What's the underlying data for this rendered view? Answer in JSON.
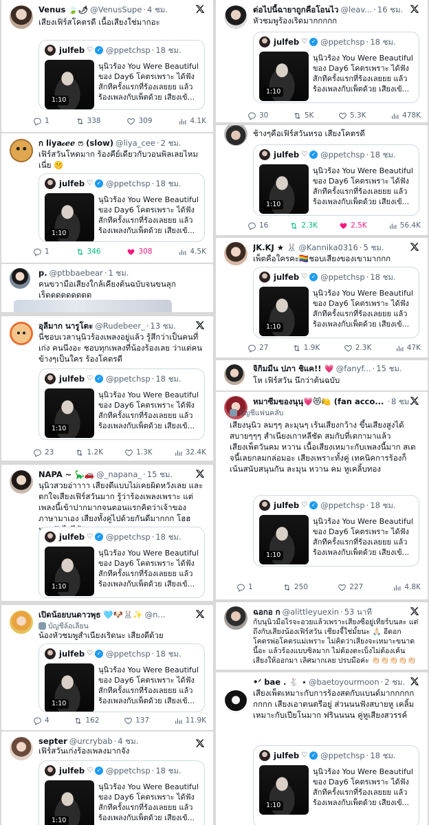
{
  "quoted": {
    "name": "julfeb",
    "heart": "♡",
    "handle": "@ppetchsp",
    "time": "18 ชม.",
    "lines": [
      "นุนิวร้อง You Were Beautiful",
      "ของ Day6 โคตรเพราะ ได้ฟัง",
      "สักทีครั้งแรกที่ร้องเลยยย แล้ว",
      "ร้องเพลงกับเพ็ตด้วย เสียงเข้..."
    ],
    "duration": "1:10"
  },
  "tweets": [
    {
      "name": "Venus 🍃🌶",
      "handle": "@VenusSupe",
      "time": "4 ชม.",
      "text": "เสียงเฟิร์สโคตรดี เนื้อเสียงใช่มากอะ",
      "stats": {
        "reply": "1",
        "retweet": "338",
        "like": "309",
        "views": "4.1K"
      }
    },
    {
      "name": "ก liya𝒸ℯℯ ෆ (slow)",
      "handle": "@liya_cee",
      "time": "2 ชม.",
      "text": "เฟิร์สวันโหดมาก ร้องคีย์เดียวกับวอนพิลเลยไหมเนี่ย 🤫",
      "stats": {
        "reply": "1",
        "retweet": "346",
        "like": "308",
        "views": "4.5K"
      }
    },
    {
      "name": "p.",
      "handle": "@ptbbaebear",
      "time": "1 ชม.",
      "text": "คนขวามือเสียงใกล้เคียงต้นฉบับจนขนลุก เร็ดดดดดดดดด"
    },
    {
      "name": "อุลีมาก นารูโตะ",
      "handle": "@Rudebeer_",
      "time": "13 ชม.",
      "text": "นี่ชอบเวลานุนิวร้องเพลงอยู่แล้ว รู้สึกว่าเป็นคนที่เก่ง คนนึงอะ ชอบทุกเพลงที่น้องร้องเลย ว่าแต่คนข้างๆเป็นใคร ร้องโคตรดี",
      "stats": {
        "reply": "23",
        "retweet": "1.2K",
        "like": "1.3K",
        "views": "32.4K"
      }
    },
    {
      "name": "NAPA ~ 🦕🚗",
      "handle": "@_napana_",
      "time": "15 ชม.",
      "text": "นุนิวสวยอ่าาาา เสียงดีแบบไม่เคยผิดหวังเลย และตกใจเสียงเฟิร์สวันมาก รู้ว่าร้องเพลงเพราะ แต่เพลงนี้เข้าปากมากจนตอนแรกคิดว่าเจ้าของภาษามาเอง เสียงทั้งคู่ไปด้วยกันดีมากกก โฮฮ หยุดฟังไม่ได้"
    },
    {
      "name": "เปิดน้อยบนดาวพุธ 🩵🐶🐰✨",
      "handle": "@n...",
      "time": "",
      "sub": "บัญชีล้อเลียน",
      "text": "น้องหัวชมพูสำเนียงเริดนะ เสียงดีด้วย",
      "stats": {
        "reply": "4",
        "retweet": "162",
        "like": "137",
        "views": "11.9K"
      }
    },
    {
      "name": "septer",
      "handle": "@urcrybab",
      "time": "4 ชม.",
      "text": "เฟิร์สวันเก่งร้องเพลงมากจัง"
    },
    {
      "name": "ต่อไปนี้ฉายาถูกคือโอนไว",
      "handle": "@leav...",
      "time": "16 ชม.",
      "text": "หัวชมพูร้องเริดมากกกกก",
      "stats": {
        "reply": "30",
        "retweet": "5K",
        "like": "5.3K",
        "views": "478K"
      }
    },
    {
      "name": "",
      "handle": "",
      "time": "",
      "text": "ช้างๆคือเฟิร์สวันหรอ เสียงโคตรดี",
      "stats": {
        "reply": "16",
        "retweet": "2.3K",
        "like": "2.5K",
        "views": "56.4K"
      }
    },
    {
      "name": "JK.KJ ★ 🐰",
      "handle": "@Kannika0316",
      "time": "5 ชม.",
      "text": "เพ็ตคือใครคะ🏳️‍🌈ชอบเสียงของเขามากกก",
      "stats": {
        "reply": "27",
        "retweet": "1.9K",
        "like": "2.3K",
        "views": "47K"
      }
    },
    {
      "name": "จิกิมมีน ปภา ชิแค!! 💗",
      "handle": "@fanyf...",
      "time": "15 ชม.",
      "text": "โห เฟิร์สวัน นึกว่าต้นฉบับ"
    },
    {
      "name": "หมาซีมของนุนุ💗😻🍋 (fan acco...",
      "handle": "",
      "time": "8 ชม.",
      "sub": "บัญชีแฟนคลับ",
      "text": "เสียงนุนิว ลมๆๆ ละมุนๆ เร้นเสียงกว้าง ขึ้นเสียงสูงได้สบายๆๆๆ สำเนียงเกาหลีชัด สมกับที่เตกามาแล้ว\nเสียงเพ็ตวันคม หวาน เนื้อเสียงเหมาะกับเพลงนี้มาก สเตจนี้เลยกลมกล่อมอะ เสียงเพราะทั้งคู่ เทคนิคการร้องก็เน้นสนับสนุนกัน ละมุน หวาน คม หูเคลิ้บทอง",
      "stats": {
        "reply": "1",
        "retweet": "250",
        "like": "227",
        "views": "4.8K"
      }
    },
    {
      "name": "ฉอกอ ก",
      "handle": "@alittleyuexin",
      "time": "53 นาที",
      "text": "กับนุนิวมือไรจะอวยแล้วเพราะเสียงซือยู่เทียร์บนละ แต่ถึงกับเสียงน้องเฟิร์สวัน เชียงจี้ใช่มั้ยนะ 🙏🏻 อีดอก โคตรพ่อโคตรแม่เพราะ ไม่คิดว่าเสียงจะเหมาะขนาดนี้อะ แล้วร้องแบบซิลมาก ไม่ต้องตะเบ็งไม่ต้องเค้นเสียงให้ออกมา เลิศมากเลย ปรบมือค่ะ 👏🏻👏🏻👏🏻👏🏻👏🏻"
    },
    {
      "name": "•ᐟ bae . 🐇 ⋆",
      "handle": "@baetoyourmoon",
      "time": "2 ชม.",
      "text": "เสียงเพ็ตเหมาะกับการร้องสตกับแบนด์มากกกกกกกกก เสียงเอาตนตรีอยู่ ส่วนนนฟังสบายหู เคลิ้มเหมาะกับเปียโนมาก ฟรินนนน คู่หูเสียงสวรรค์"
    }
  ],
  "colors": {
    "retweet_active": "#00ba7c",
    "like_active": "#f91880",
    "verified": "#1d9bf0"
  }
}
